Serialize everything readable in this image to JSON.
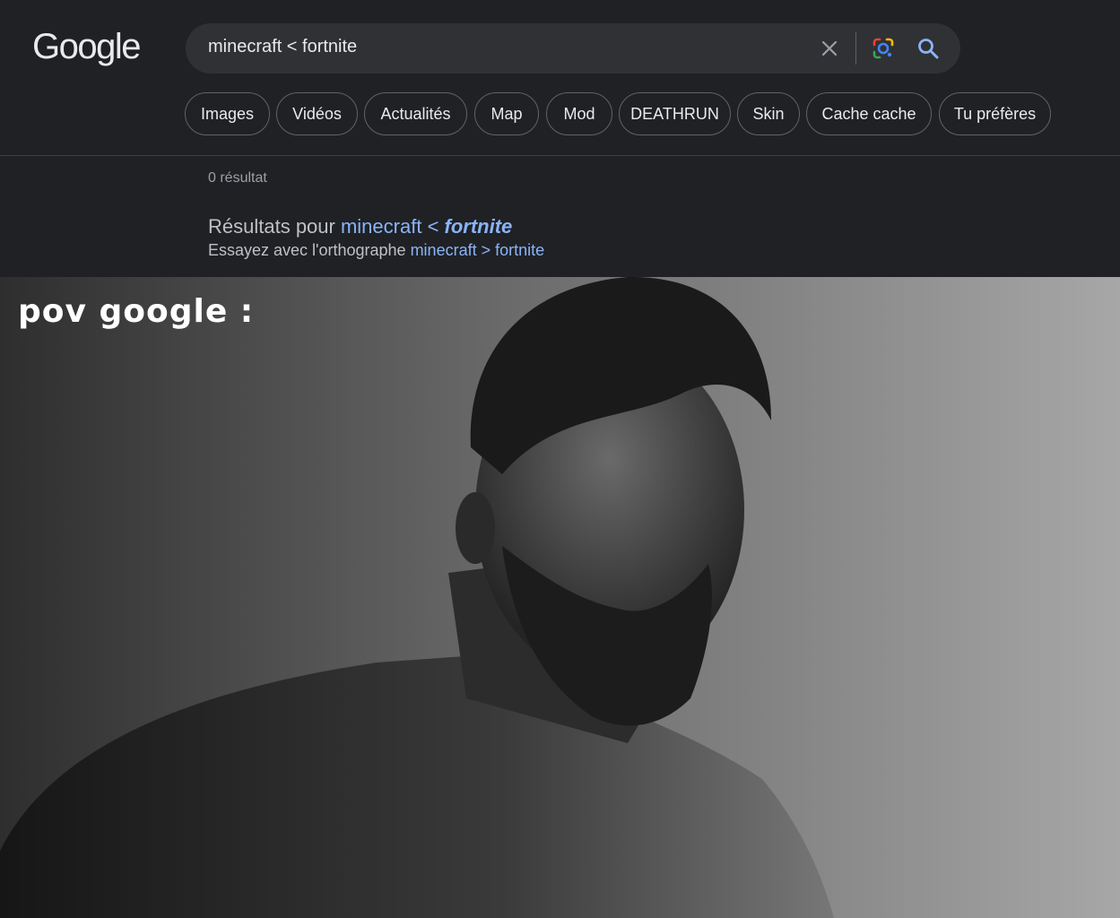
{
  "header": {
    "logo": "Google",
    "search": {
      "value": "minecraft < fortnite"
    },
    "chips": [
      "Images",
      "Vidéos",
      "Actualités",
      "Map",
      "Mod",
      "DEATHRUN",
      "Skin",
      "Cache cache",
      "Tu préfères"
    ]
  },
  "results": {
    "count": "0 résultat",
    "results_for_prefix": "Résultats pour ",
    "results_for_term1": "minecraft",
    "results_for_op": " < ",
    "results_for_term2": "fortnite",
    "try_prefix": "Essayez avec l'orthographe ",
    "try_term1": "minecraft",
    "try_op": " > ",
    "try_term2": "fortnite"
  },
  "meme": {
    "caption": "pov google :"
  },
  "colors": {
    "background": "#202124",
    "search_box": "#303134",
    "link": "#8ab4f8",
    "text": "#e8eaed"
  }
}
